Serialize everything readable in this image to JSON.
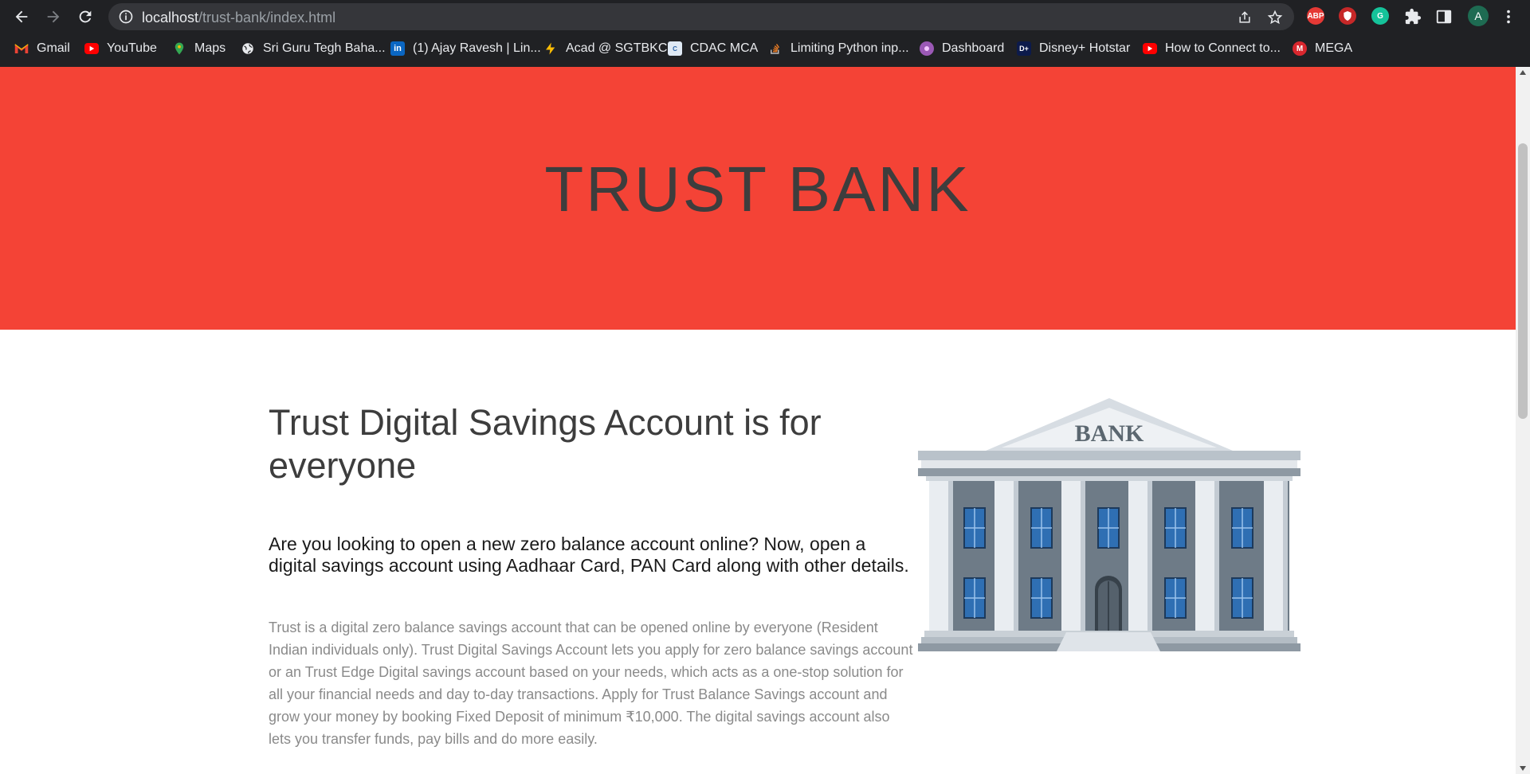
{
  "browser": {
    "url_host": "localhost",
    "url_path": "/trust-bank/index.html",
    "profile_initial": "A",
    "extensions": [
      {
        "name": "adblock-plus",
        "label": "ABP",
        "color": "#e53935"
      },
      {
        "name": "vpn-extension",
        "label": "",
        "color": "#c62828"
      },
      {
        "name": "grammarly",
        "label": "G",
        "color": "#15c39a"
      }
    ]
  },
  "bookmarks": [
    {
      "label": "Gmail",
      "icon": "gmail-icon",
      "color": "#ea4335"
    },
    {
      "label": "YouTube",
      "icon": "youtube-icon",
      "color": "#ff0000"
    },
    {
      "label": "Maps",
      "icon": "maps-icon",
      "color": "#34a853"
    },
    {
      "label": "Sri Guru Tegh Baha...",
      "icon": "globe-icon",
      "color": "#e8eaed"
    },
    {
      "label": "(1) Ajay Ravesh | Lin...",
      "icon": "linkedin-icon",
      "color": "#0a66c2"
    },
    {
      "label": "Acad @ SGTBKC",
      "icon": "lightning-icon",
      "color": "#fbbc04"
    },
    {
      "label": "CDAC MCA",
      "icon": "cdac-icon",
      "color": "#4a90c8"
    },
    {
      "label": "Limiting Python inp...",
      "icon": "stackoverflow-icon",
      "color": "#f48024"
    },
    {
      "label": "Dashboard",
      "icon": "dashboard-icon",
      "color": "#9b59b6"
    },
    {
      "label": "Disney+ Hotstar",
      "icon": "hotstar-icon",
      "color": "#0c1a4b"
    },
    {
      "label": "How to Connect to...",
      "icon": "youtube-icon",
      "color": "#ff0000"
    },
    {
      "label": "MEGA",
      "icon": "mega-icon",
      "color": "#d9272e"
    }
  ],
  "hero": {
    "title": "TRUST BANK",
    "background": "#f44336"
  },
  "content": {
    "headline": "Trust Digital Savings Account is for everyone",
    "subhead": "Are you looking to open a new zero balance account online? Now, open a digital savings account using Aadhaar Card, PAN Card along with other details.",
    "body": "Trust is a digital zero balance savings account that can be opened online by everyone (Resident Indian individuals only). Trust Digital Savings Account lets you apply for zero balance savings account or an Trust Edge Digital savings account based on your needs, which acts as a one-stop solution for all your financial needs and day to-day transactions. Apply for Trust Balance Savings account and grow your money by booking Fixed Deposit of minimum ₹10,000. The digital savings account also lets you transfer funds, pay bills and do more easily."
  },
  "illustration": {
    "sign_text": "BANK",
    "icon": "bank-building-illustration"
  }
}
